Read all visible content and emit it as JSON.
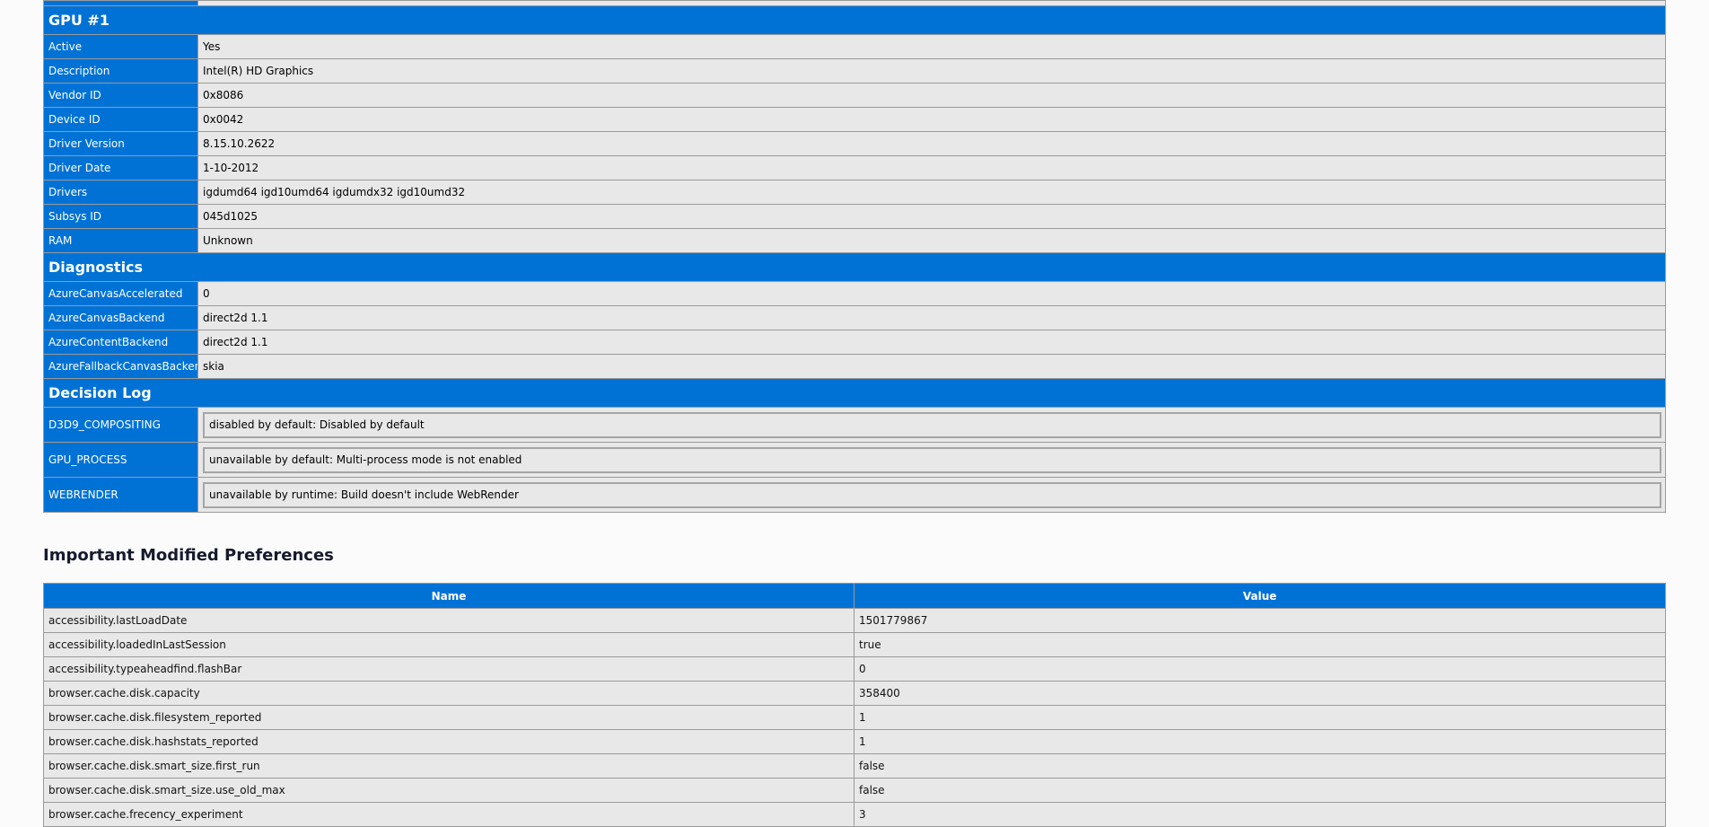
{
  "gpu": {
    "title": "GPU #1",
    "rows": [
      {
        "key": "Active",
        "value": "Yes"
      },
      {
        "key": "Description",
        "value": "Intel(R) HD Graphics"
      },
      {
        "key": "Vendor ID",
        "value": "0x8086"
      },
      {
        "key": "Device ID",
        "value": "0x0042"
      },
      {
        "key": "Driver Version",
        "value": "8.15.10.2622"
      },
      {
        "key": "Driver Date",
        "value": "1-10-2012"
      },
      {
        "key": "Drivers",
        "value": "igdumd64 igd10umd64 igdumdx32 igd10umd32"
      },
      {
        "key": "Subsys ID",
        "value": "045d1025"
      },
      {
        "key": "RAM",
        "value": "Unknown"
      }
    ]
  },
  "diagnostics": {
    "title": "Diagnostics",
    "rows": [
      {
        "key": "AzureCanvasAccelerated",
        "value": "0"
      },
      {
        "key": "AzureCanvasBackend",
        "value": "direct2d 1.1"
      },
      {
        "key": "AzureContentBackend",
        "value": "direct2d 1.1"
      },
      {
        "key": "AzureFallbackCanvasBackend",
        "value": "skia"
      }
    ]
  },
  "decision_log": {
    "title": "Decision Log",
    "rows": [
      {
        "key": "D3D9_COMPOSITING",
        "value": "disabled by default: Disabled by default"
      },
      {
        "key": "GPU_PROCESS",
        "value": "unavailable by default: Multi-process mode is not enabled"
      },
      {
        "key": "WEBRENDER",
        "value": "unavailable by runtime: Build doesn't include WebRender"
      }
    ]
  },
  "prefs": {
    "title": "Important Modified Preferences",
    "col_name": "Name",
    "col_value": "Value",
    "rows": [
      {
        "name": "accessibility.lastLoadDate",
        "value": "1501779867"
      },
      {
        "name": "accessibility.loadedInLastSession",
        "value": "true"
      },
      {
        "name": "accessibility.typeaheadfind.flashBar",
        "value": "0"
      },
      {
        "name": "browser.cache.disk.capacity",
        "value": "358400"
      },
      {
        "name": "browser.cache.disk.filesystem_reported",
        "value": "1"
      },
      {
        "name": "browser.cache.disk.hashstats_reported",
        "value": "1"
      },
      {
        "name": "browser.cache.disk.smart_size.first_run",
        "value": "false"
      },
      {
        "name": "browser.cache.disk.smart_size.use_old_max",
        "value": "false"
      },
      {
        "name": "browser.cache.frecency_experiment",
        "value": "3"
      }
    ]
  },
  "colors": {
    "header_blue": "#0072d6",
    "cell_gray": "#e8e8e8",
    "page_bg": "#fbfbfb"
  }
}
